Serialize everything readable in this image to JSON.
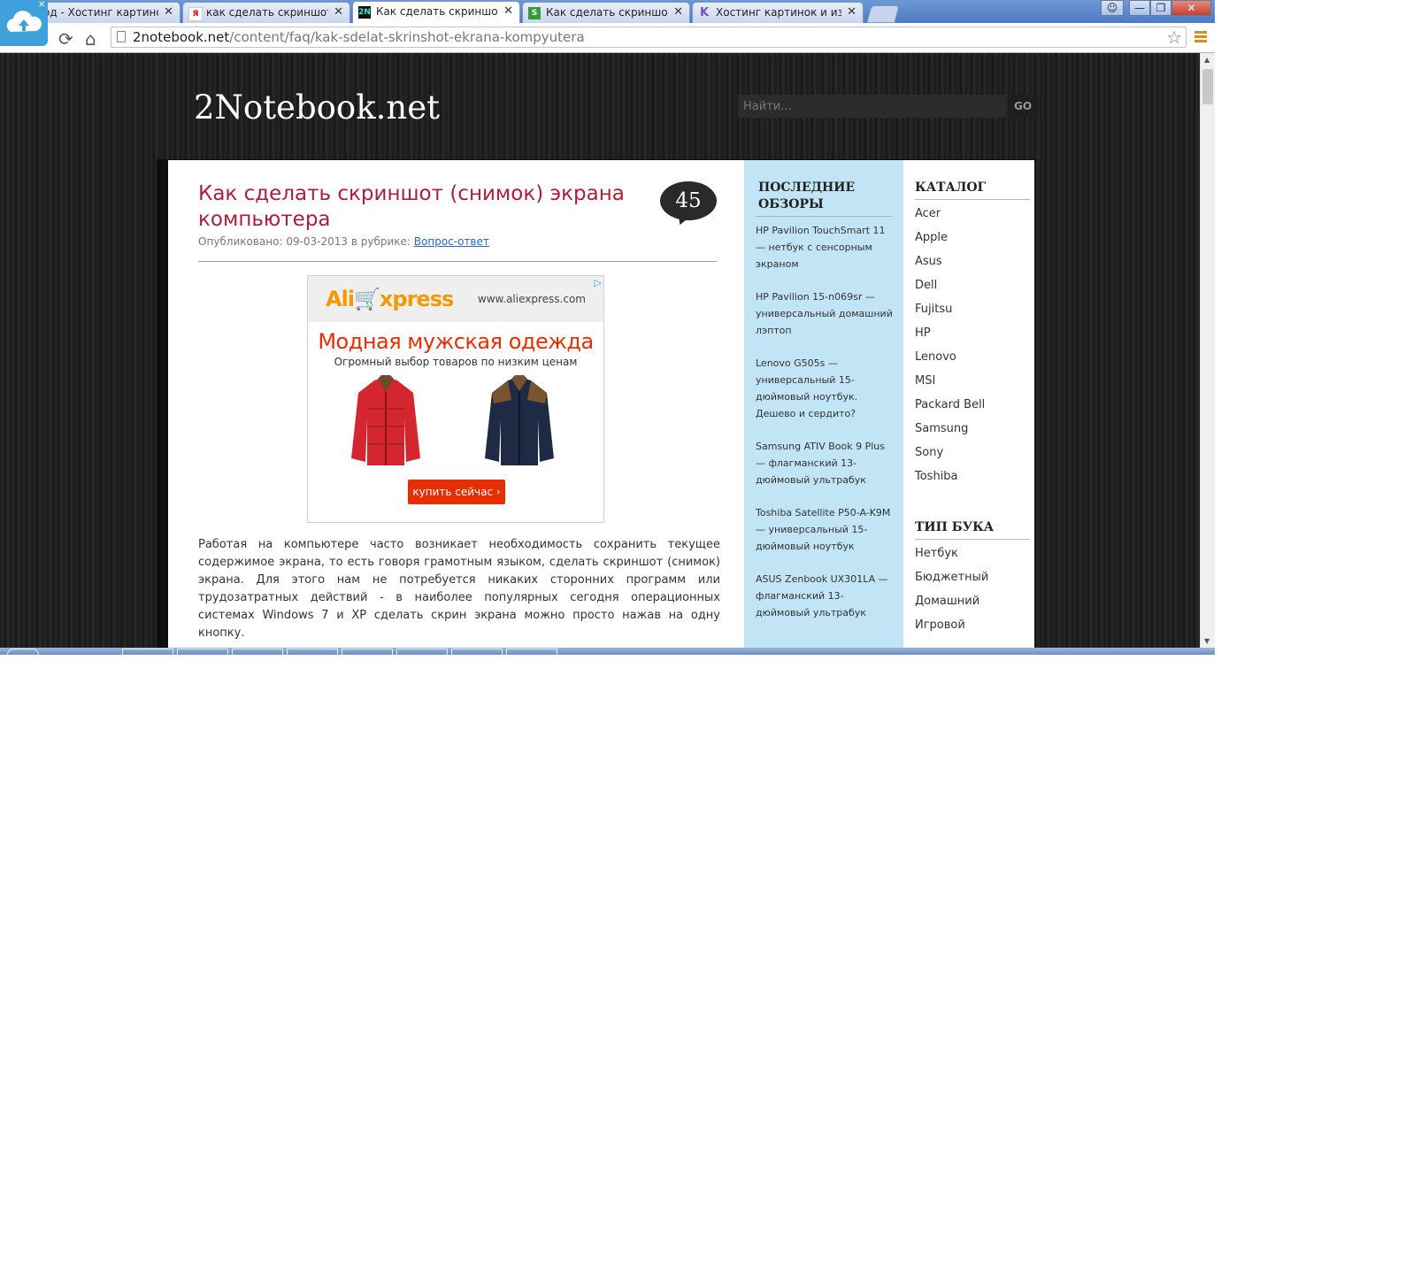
{
  "browser": {
    "tabs": [
      {
        "label": "од - Хостинг картинок",
        "icon": "image-hosting-icon"
      },
      {
        "label": "как сделать скриншот эк",
        "icon": "yandex-icon",
        "icon_text": "Я"
      },
      {
        "label": "Как сделать скриншот (с",
        "icon": "2notebook-icon",
        "icon_text": "2N",
        "active": true
      },
      {
        "label": "Как сделать скриншот эк",
        "icon": "s-site-icon",
        "icon_text": "S"
      },
      {
        "label": "Хостинг картинок и изоб",
        "icon": "k-site-icon",
        "icon_text": "K"
      }
    ],
    "tab_close": "✕",
    "url_domain": "2notebook.net",
    "url_path": "/content/faq/kak-sdelat-skrinshot-ekrana-kompyutera"
  },
  "site": {
    "logo": "2Notebook.net",
    "search_placeholder": "Найти...",
    "search_go": "GO"
  },
  "article": {
    "title": "Как сделать скриншот (снимок) экрана компьютера",
    "comments_count": "45",
    "meta_prefix": "Опубликовано: 09-03-2013 в рубрике: ",
    "category": "Вопрос-ответ",
    "body": "Работая на компьютере часто возникает необходимость сохранить текущее содержимое экрана, то есть говоря грамотным языком, сделать скриншот (снимок) экрана. Для этого нам не потребуется никаких сторонних программ или трудозатратных действий - в наиболее популярных сегодня операционных системах Windows 7 и XP сделать скрин экрана можно просто нажав на одну кнопку."
  },
  "ad": {
    "logo_part1": "Ali",
    "logo_part2": "xpress",
    "site": "www.aliexpress.com",
    "headline": "Модная мужская одежда",
    "subline": "Огромный выбор товаров по низким ценам",
    "button": "купить сейчас ›"
  },
  "sidebar_reviews": {
    "title": "ПОСЛЕДНИЕ ОБЗОРЫ",
    "items": [
      "HP Pavilion TouchSmart 11 — нетбук с сенсорным экраном",
      "HP Pavilion 15-n069sr — универсальный домашний лэптоп",
      "Lenovo G505s — универсальный 15-дюймовый ноутбук. Дешево и сердито?",
      "Samsung ATIV Book 9 Plus — флагманский 13-дюймовый ультрабук",
      "Toshiba Satellite P50-A-K9M — универсальный 15-дюймовый ноутбук",
      "ASUS Zenbook UX301LA — флагманский 13-дюймовый ультрабук"
    ]
  },
  "sidebar_catalog": {
    "title": "КАТАЛОГ",
    "items": [
      "Acer",
      "Apple",
      "Asus",
      "Dell",
      "Fujitsu",
      "HP",
      "Lenovo",
      "MSI",
      "Packard Bell",
      "Samsung",
      "Sony",
      "Toshiba"
    ],
    "type_title": "ТИП БУКА",
    "type_items": [
      "Нетбук",
      "Бюджетный",
      "Домашний",
      "Игровой"
    ]
  },
  "colors": {
    "title_red": "#a8203a",
    "sidebar_blue": "#c1e5f5",
    "ali_orange": "#f39a00",
    "ali_red": "#e62e04"
  }
}
